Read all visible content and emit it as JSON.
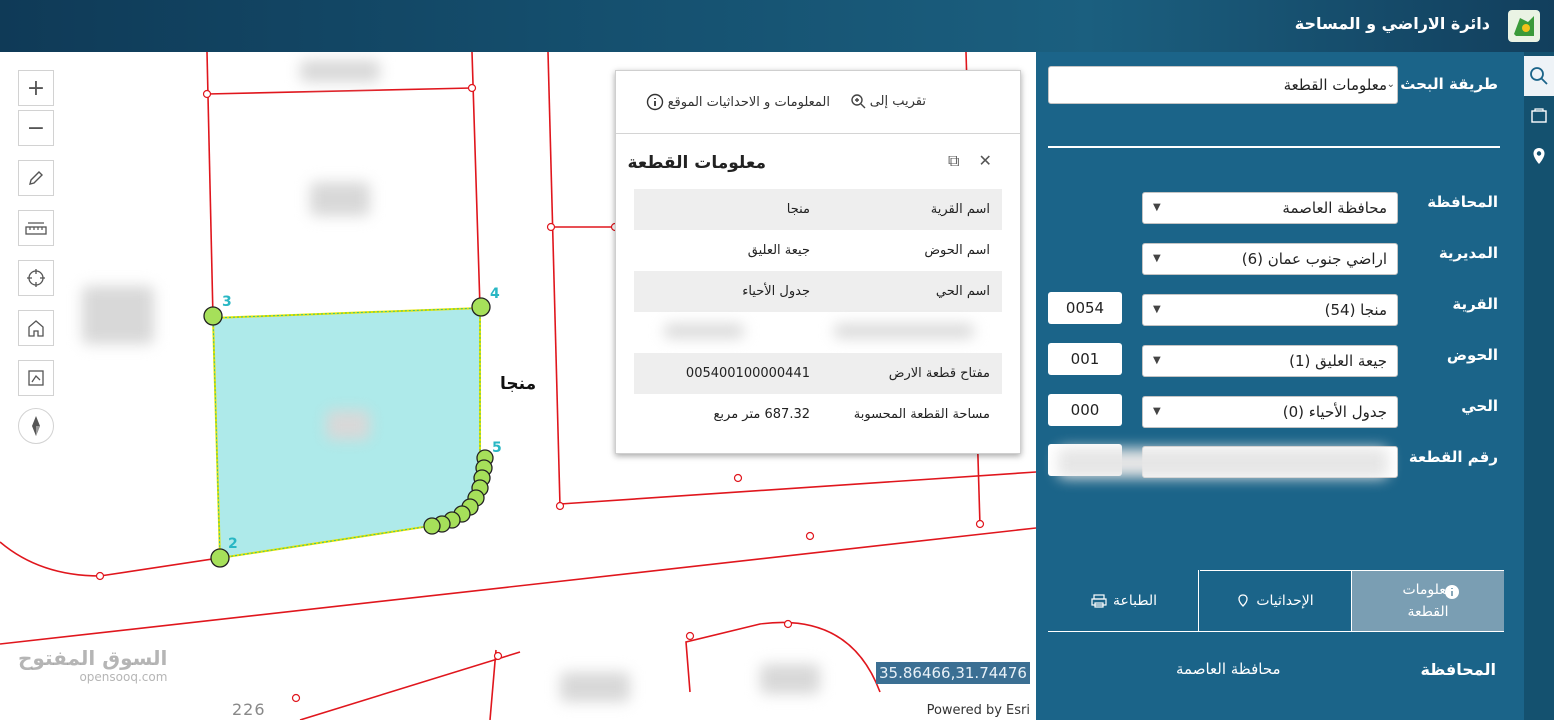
{
  "header": {
    "title": "دائرة الاراضي و المساحة"
  },
  "map": {
    "village_label": "منجا",
    "coordinates": "35.86466,31.74476",
    "powered_by": "Powered by Esri",
    "scale_text": "226",
    "vertex_labels": [
      "2",
      "3",
      "4",
      "5"
    ],
    "tools": [
      "zoom-in",
      "zoom-out",
      "draw",
      "measure",
      "locate",
      "home",
      "select",
      "compass"
    ],
    "watermark": {
      "brand": "السوق المفتوح",
      "domain": "opensooq.com"
    }
  },
  "popup": {
    "actions": {
      "zoom_to": "تقريب إلى",
      "info": "المعلومات و الاحداثيات الموقع"
    },
    "title": "معلومات القطعة",
    "rows": [
      {
        "key": "اسم القرية",
        "value": "منجا"
      },
      {
        "key": "اسم الحوض",
        "value": "جيعة العليق"
      },
      {
        "key": "اسم الحي",
        "value": "جدول الأحياء"
      },
      {
        "key": "",
        "value": ""
      },
      {
        "key": "مفتاح قطعة الارض",
        "value": "005400100000441"
      },
      {
        "key": "مساحة القطعة المحسوبة",
        "value": "687.32 متر مربع"
      }
    ]
  },
  "panel": {
    "search_method_label": "طريقة البحث",
    "search_method_value": "معلومات القطعة",
    "fields": [
      {
        "label": "المحافظة",
        "value": "محافظة العاصمة",
        "code": ""
      },
      {
        "label": "المديرية",
        "value": "اراضي جنوب عمان (6)",
        "code": ""
      },
      {
        "label": "القرية",
        "value": "منجا (54)",
        "code": "0054"
      },
      {
        "label": "الحوض",
        "value": "جيعة العليق (1)",
        "code": "001"
      },
      {
        "label": "الحي",
        "value": "جدول الأحياء (0)",
        "code": "000"
      },
      {
        "label": "رقم القطعة",
        "value": "",
        "code": ""
      }
    ],
    "tabs": [
      {
        "label": "معلومات القطعة",
        "icon": "info-icon",
        "active": true
      },
      {
        "label": "الإحداثيات",
        "icon": "location-icon",
        "active": false
      },
      {
        "label": "الطباعة",
        "icon": "printer-icon",
        "active": false
      }
    ],
    "result": {
      "label": "المحافظة",
      "value": "محافظة العاصمة"
    }
  },
  "sidebar": {
    "items": [
      "search-icon",
      "layers-icon",
      "map-pin-icon"
    ]
  },
  "colors": {
    "panel": "#1b6489",
    "header": "#15506f",
    "parcel_fill": "#aeeaea",
    "parcel_line": "#e8e400",
    "road_line": "#e0161d",
    "vertex": "#a6e05a"
  }
}
